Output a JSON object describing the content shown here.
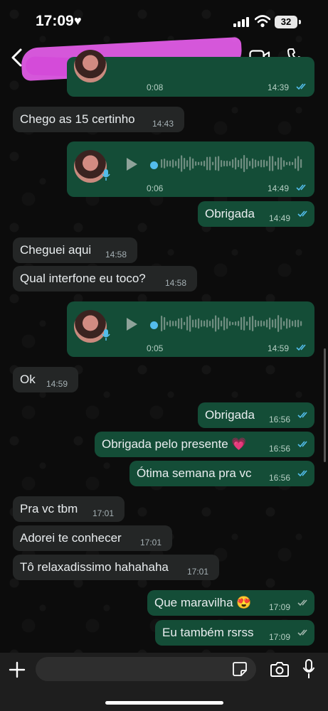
{
  "status_bar": {
    "time": "17:09",
    "battery": "32"
  },
  "header": {
    "contact_name": ""
  },
  "messages": [
    {
      "kind": "voice",
      "duration": "0:08",
      "time": "14:39"
    },
    {
      "kind": "text",
      "text": "Chego as 15 certinho",
      "time": "14:43"
    },
    {
      "kind": "voice",
      "duration": "0:06",
      "time": "14:49"
    },
    {
      "kind": "text",
      "text": "Obrigada",
      "time": "14:49"
    },
    {
      "kind": "text",
      "text": "Cheguei aqui",
      "time": "14:58"
    },
    {
      "kind": "text",
      "text": "Qual interfone eu toco?",
      "time": "14:58"
    },
    {
      "kind": "voice",
      "duration": "0:05",
      "time": "14:59"
    },
    {
      "kind": "text",
      "text": "Ok",
      "time": "14:59"
    },
    {
      "kind": "text",
      "text": "Obrigada",
      "time": "16:56"
    },
    {
      "kind": "text",
      "text": "Obrigada pelo presente 💗",
      "time": "16:56"
    },
    {
      "kind": "text",
      "text": "Ótima semana pra vc",
      "time": "16:56"
    },
    {
      "kind": "text",
      "text": "Pra vc tbm",
      "time": "17:01"
    },
    {
      "kind": "text",
      "text": "Adorei te conhecer",
      "time": "17:01"
    },
    {
      "kind": "text",
      "text": "Tô relaxadissimo hahahaha",
      "time": "17:01"
    },
    {
      "kind": "text",
      "text": "Que maravilha 😍",
      "time": "17:09"
    },
    {
      "kind": "text",
      "text": "Eu também rsrss",
      "time": "17:09"
    }
  ],
  "composer": {
    "placeholder": ""
  },
  "colors": {
    "outgoing": "#144d37",
    "incoming": "#242626",
    "read_ticks": "#53bdeb",
    "redaction": "#e05ce6"
  }
}
